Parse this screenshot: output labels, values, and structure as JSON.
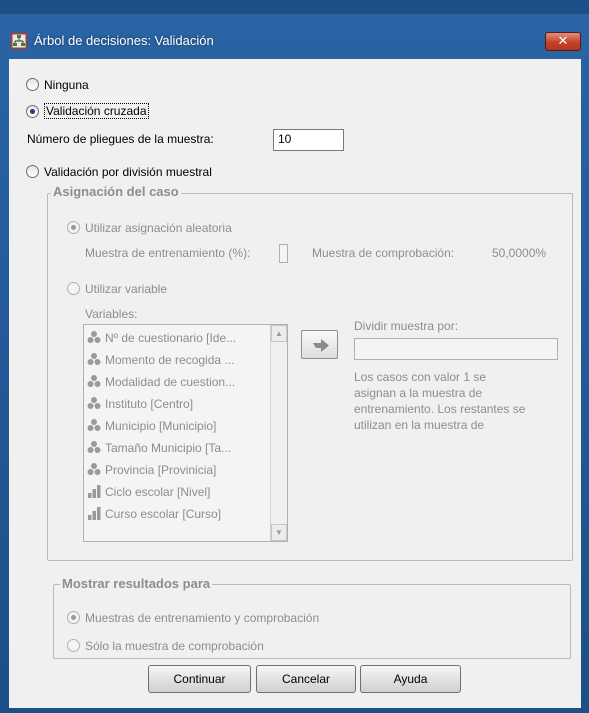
{
  "window": {
    "title": "Árbol de decisiones: Validación",
    "close_glyph": "✕"
  },
  "validation": {
    "option_none": "Ninguna",
    "option_cross": "Validación cruzada",
    "folds_label": "Número de pliegues de la muestra:",
    "folds_value": "10",
    "option_split": "Validación por división muestral"
  },
  "case_assignment": {
    "title": "Asignación del caso",
    "random_option": "Utilizar asignación aleatoria",
    "training_label": "Muestra de entrenamiento (%):",
    "training_value": "",
    "test_label": "Muestra de comprobación:",
    "test_value": "50,0000%",
    "variable_option": "Utilizar variable",
    "variables_label": "Variables:",
    "variables": [
      {
        "label": "Nº de cuestionario [Ide...",
        "icon": "nominal-icon"
      },
      {
        "label": "Momento de recogida ...",
        "icon": "nominal-icon"
      },
      {
        "label": "Modalidad de cuestion...",
        "icon": "nominal-icon"
      },
      {
        "label": "Instituto [Centro]",
        "icon": "nominal-icon"
      },
      {
        "label": "Municipio [Municipio]",
        "icon": "nominal-icon"
      },
      {
        "label": "Tamaño Municipio [Ta...",
        "icon": "nominal-icon"
      },
      {
        "label": "Provincia [Provinicia]",
        "icon": "nominal-icon"
      },
      {
        "label": "Ciclo escolar [Nivel]",
        "icon": "ordinal-icon"
      },
      {
        "label": "Curso escolar [Curso]",
        "icon": "ordinal-icon"
      }
    ],
    "split_label": "Dividir muestra por:",
    "split_value": "",
    "help_lines": [
      "Los casos con valor 1 se",
      "asignan a la muestra de",
      "entrenamiento. Los restantes se",
      "utilizan en la muestra de"
    ]
  },
  "show_results": {
    "title": "Mostrar resultados para",
    "option_both": "Muestras de entrenamiento y comprobación",
    "option_test": "Sólo la muestra de comprobación"
  },
  "buttons": {
    "continue": "Continuar",
    "cancel": "Cancelar",
    "help": "Ayuda"
  },
  "colors": {
    "titlebar": "#1e4f86",
    "dialog_bg": "#f0f0f0",
    "disabled_text": "#8d8d8d",
    "close_button": "#c4422b"
  }
}
